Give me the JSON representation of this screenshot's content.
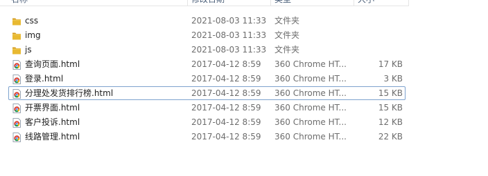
{
  "columns": {
    "name": "名称",
    "date": "修改日期",
    "type": "类型",
    "size": "大小"
  },
  "files": [
    {
      "name": "css",
      "date": "2021-08-03 11:33",
      "type": "文件夹",
      "size": "",
      "icon": "folder-icon"
    },
    {
      "name": "img",
      "date": "2021-08-03 11:33",
      "type": "文件夹",
      "size": "",
      "icon": "folder-icon"
    },
    {
      "name": "js",
      "date": "2021-08-03 11:33",
      "type": "文件夹",
      "size": "",
      "icon": "folder-icon"
    },
    {
      "name": "查询页面.html",
      "date": "2017-04-12 8:59",
      "type": "360 Chrome HT...",
      "size": "17 KB",
      "icon": "chrome-html-icon"
    },
    {
      "name": "登录.html",
      "date": "2017-04-12 8:59",
      "type": "360 Chrome HT...",
      "size": "3 KB",
      "icon": "chrome-html-icon"
    },
    {
      "name": "分理处发货排行榜.html",
      "date": "2017-04-12 8:59",
      "type": "360 Chrome HT...",
      "size": "15 KB",
      "icon": "chrome-html-icon"
    },
    {
      "name": "开票界面.html",
      "date": "2017-04-12 8:59",
      "type": "360 Chrome HT...",
      "size": "15 KB",
      "icon": "chrome-html-icon"
    },
    {
      "name": "客户投诉.html",
      "date": "2017-04-12 8:59",
      "type": "360 Chrome HT...",
      "size": "12 KB",
      "icon": "chrome-html-icon"
    },
    {
      "name": "线路管理.html",
      "date": "2017-04-12 8:59",
      "type": "360 Chrome HT...",
      "size": "22 KB",
      "icon": "chrome-html-icon"
    }
  ],
  "colors": {
    "folder": "#e8b931",
    "folder_dark": "#d49b1f",
    "focus_border": "#7da2ce",
    "header_text": "#4c607a"
  }
}
